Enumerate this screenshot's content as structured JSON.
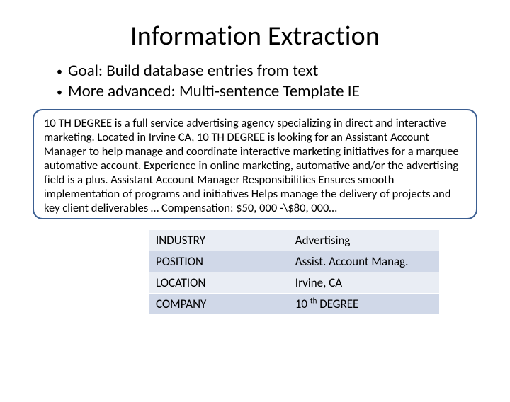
{
  "title": "Information Extraction",
  "bullets": [
    "Goal:  Build database entries from text",
    "More advanced:  Multi-sentence Template IE"
  ],
  "textbox": "10 TH DEGREE is a full service advertising agency specializing in direct and interactive marketing. Located in Irvine CA, 10 TH DEGREE is looking for an Assistant Account Manager to help manage and coordinate interactive  marketing initiatives for a marquee automative account. Experience in online  marketing, automative and/or the advertising field is a plus.  Assistant Account Manager Responsibilities Ensures smooth implementation of programs and initiatives Helps manage the delivery of projects and key client deliverables  … Compensation: $50, 000 -\\$80, 000…",
  "table": {
    "rows": [
      {
        "key": "INDUSTRY",
        "value": "Advertising"
      },
      {
        "key": "POSITION",
        "value": "Assist. Account Manag."
      },
      {
        "key": "LOCATION",
        "value": "Irvine, CA"
      },
      {
        "key": "COMPANY",
        "value_parts": [
          "10 ",
          "th",
          " DEGREE"
        ]
      }
    ]
  }
}
